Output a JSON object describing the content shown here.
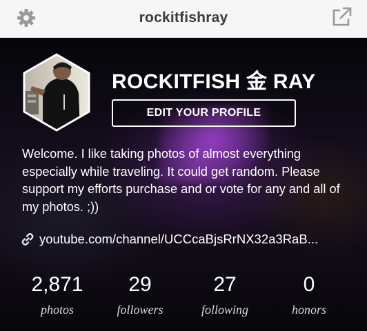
{
  "header": {
    "username": "rockitfishray",
    "left_icon": "gear-icon",
    "right_icon": "share-icon"
  },
  "profile": {
    "display_name": "ROCKITFISH 金 RAY",
    "edit_button_label": "EDIT YOUR PROFILE",
    "bio": "Welcome. I like taking photos of almost everything especially while traveling. It could get random. Please support my efforts purchase and or vote for any and all of my photos. ;))",
    "link_icon": "link-icon",
    "link_text": "youtube.com/channel/UCCcaBjsRrNX32a3RaB..."
  },
  "stats": [
    {
      "value": "2,871",
      "label": "photos"
    },
    {
      "value": "29",
      "label": "followers"
    },
    {
      "value": "27",
      "label": "following"
    },
    {
      "value": "0",
      "label": "honors"
    }
  ],
  "colors": {
    "header_bg": "#f6f6f6",
    "header_text": "#3b3b3b",
    "icon_gray": "#9a9a9a",
    "text": "#ffffff"
  }
}
